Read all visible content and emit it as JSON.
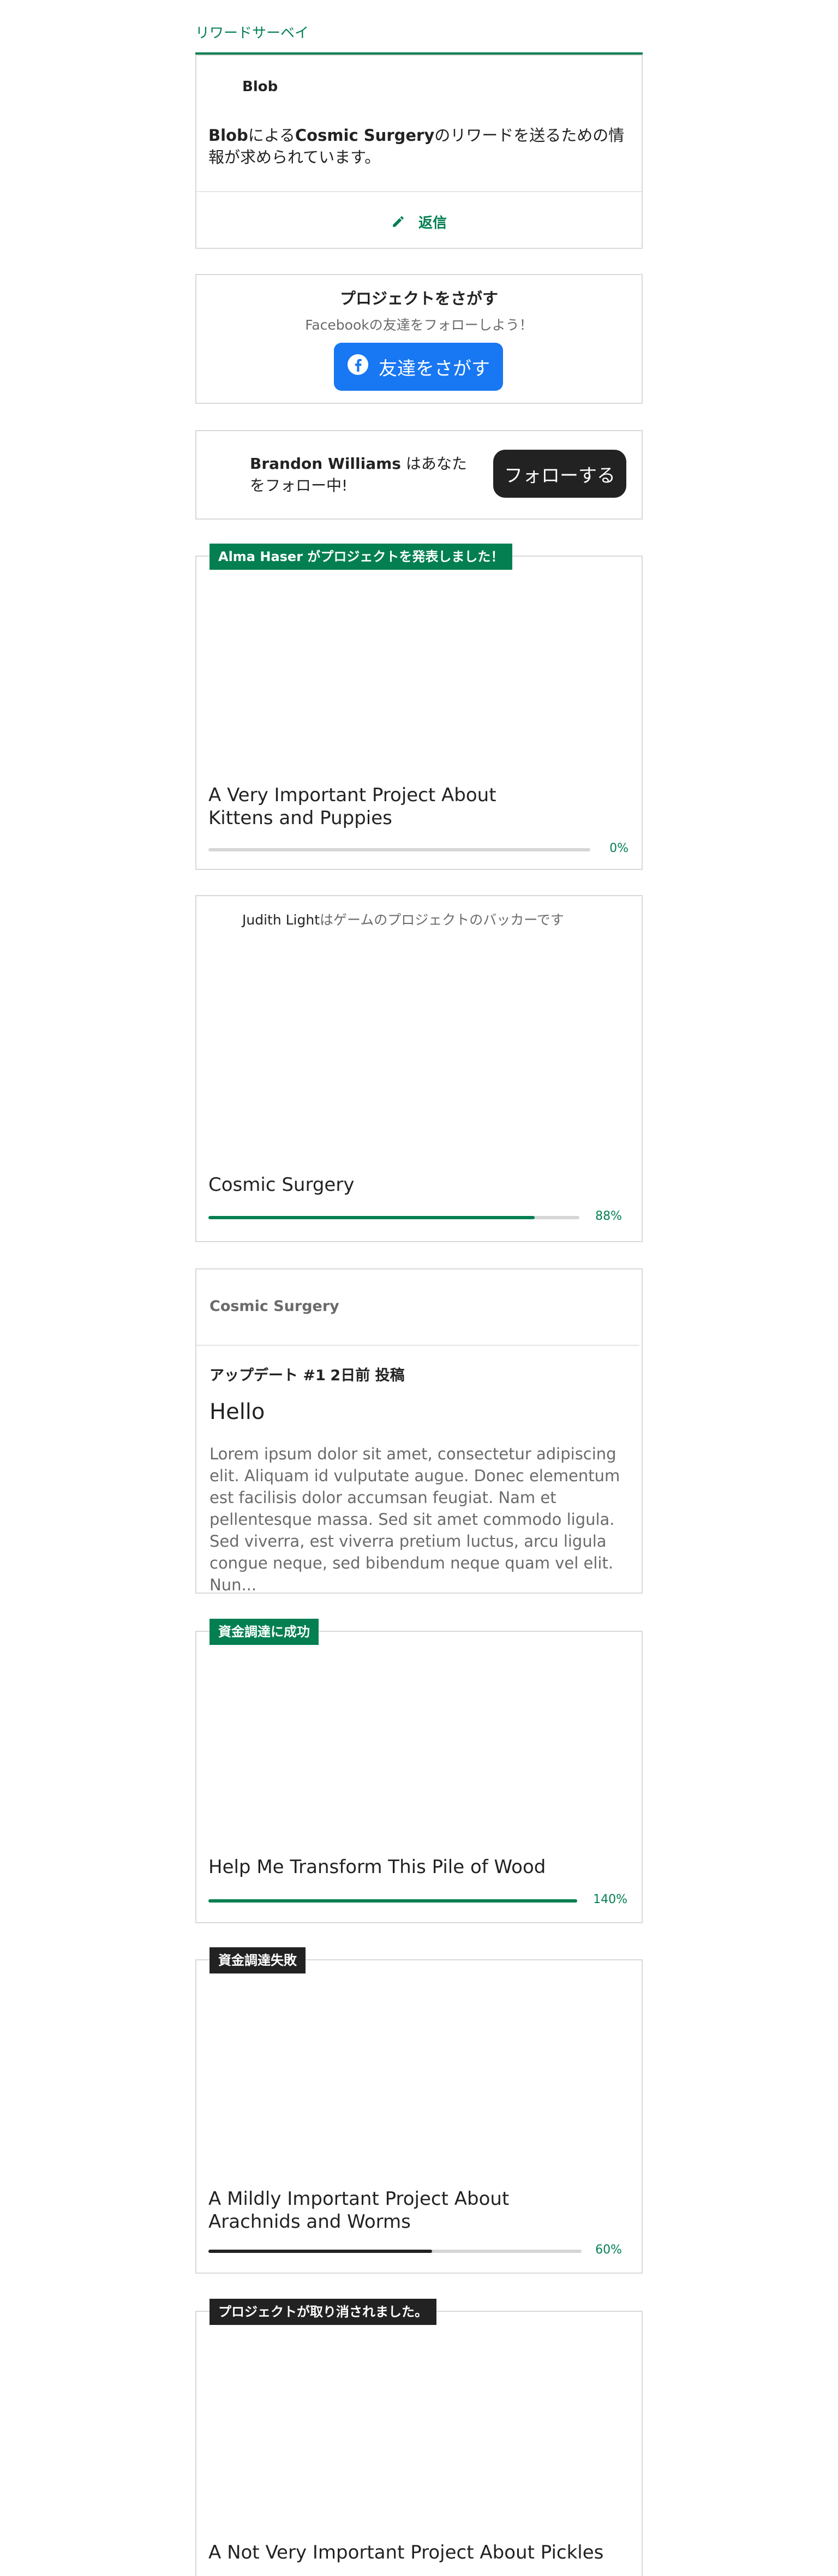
{
  "survey": {
    "section_title": "リワードサーベイ",
    "creator": "Blob",
    "message_creator": "Blob",
    "message_by": "による",
    "message_project": "Cosmic Surgery",
    "message_rest": "のリワードを送るための情報が求められています。",
    "reply_label": "返信"
  },
  "find": {
    "title": "プロジェクトをさがす",
    "subtitle": "Facebookの友達をフォローしよう！",
    "button_label": "友達をさがす"
  },
  "follow": {
    "name": "Brandon Williams",
    "message": " はあなたをフォロー中!",
    "button_label": "フォローする"
  },
  "launched": {
    "badge": "Alma Haser がプロジェクトを発表しました！",
    "title": "A Very Important Project About Kittens and Puppies",
    "percent_label": "0%",
    "progress": 0
  },
  "backing": {
    "backer": "Judith Light",
    "message": "はゲームのプロジェクトのバッカーです",
    "title": "Cosmic Surgery",
    "percent_label": "88%",
    "progress": 0.88
  },
  "update": {
    "project": "Cosmic Surgery",
    "meta_prefix": "アップデート #1",
    "meta_time": "2日前 投稿",
    "title": "Hello",
    "body": "Lorem ipsum dolor sit amet, consectetur adipiscing elit. Aliquam id vulputate augue. Donec elementum est facilisis dolor accumsan feugiat. Nam et pellentesque massa. Sed sit amet commodo ligula. Sed viverra, est viverra pretium luctus, arcu ligula congue neque, sed bibendum neque quam vel elit. Nun..."
  },
  "success": {
    "badge": "資金調達に成功",
    "title": "Help Me Transform This Pile of Wood",
    "percent_label": "140%",
    "progress": 1.0
  },
  "failed": {
    "badge": "資金調達失敗",
    "title": "A Mildly Important Project About Arachnids and Worms",
    "percent_label": "60%",
    "progress": 0.6
  },
  "canceled": {
    "badge": "プロジェクトが取り消されました。",
    "title": "A Not Very Important Project About Pickles"
  },
  "colors": {
    "brand_green": "#037f51",
    "facebook_blue": "#1877f2",
    "dark": "#222222"
  }
}
